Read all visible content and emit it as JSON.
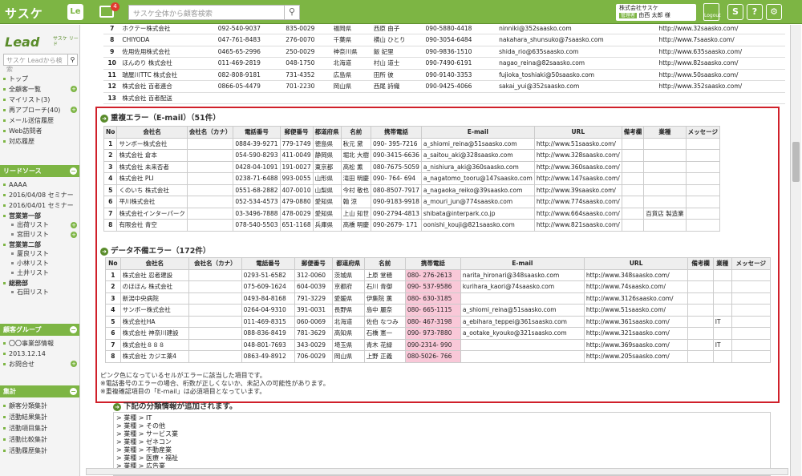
{
  "topbar": {
    "logo": "サスケ",
    "le": "Le",
    "badge": "4",
    "search_placeholder": "サスケ全体から顧客検索",
    "company": "株式会社サスケ",
    "role": "管理者",
    "user": "由西 太郎 様",
    "logout": "Logout"
  },
  "sidebar": {
    "lead_logo": "Lead",
    "lead_sub": "サスケ リード",
    "search_placeholder": "サスケ Leadから検索",
    "items": [
      "トップ",
      "全顧客一覧",
      "マイリスト(3)",
      "再アプローチ(40)",
      "メール送信履歴",
      "Web訪問者",
      "対応履歴"
    ],
    "sec_leadsource": "リードソース",
    "leadsource": [
      "AAAA",
      "2016/04/08 セミナー",
      "2016/04/01 セミナー"
    ],
    "eigyo1": "営業第一部",
    "eigyo1_sub": [
      "出荷リスト",
      "宮田リスト"
    ],
    "eigyo2": "営業第二部",
    "eigyo2_sub": [
      "厦良リスト",
      "小林リスト",
      "土井リスト"
    ],
    "somu": "総務部",
    "somu_sub": [
      "石田リスト"
    ],
    "sec_group": "顧客グループ",
    "group": [
      "〇〇事業部情報",
      "2013.12.14",
      "お問合せ"
    ],
    "sec_aggr": "集計",
    "aggr": [
      "顧客分類集計",
      "活動結果集計",
      "活動項目集計",
      "活動比較集計",
      "活動履歴集計"
    ]
  },
  "top_rows": [
    [
      "7",
      "ホクテー株式会社",
      "",
      "",
      "092-540-9037",
      "835-0029",
      "福岡県",
      "西原 由子",
      "090-5880-4418",
      "ninniki@352saasko.com",
      "http://www.32saasko.com/"
    ],
    [
      "8",
      "CHIYODA",
      "",
      "",
      "047-761-8483",
      "276-0070",
      "千葉県",
      "横山 ひとり",
      "090-3054-6484",
      "nakahara_shunsuko@7saasko.com",
      "http://www.7saasko.com/"
    ],
    [
      "9",
      "佐用佐用株式会社",
      "",
      "",
      "0465-65-2996",
      "250-0029",
      "神奈川県",
      "飯 妃里",
      "090-9836-1510",
      "shida_rio@635saasko.com",
      "http://www.635saasko.com/"
    ],
    [
      "10",
      "ほんのり 株式会社",
      "",
      "",
      "011-469-2819",
      "048-1750",
      "北海道",
      "村山 道士",
      "090-7490-6191",
      "nagao_reina@82saasko.com",
      "http://www.82saasko.com/"
    ],
    [
      "11",
      "瑞屋川TTC 株式会社",
      "",
      "",
      "082-808-9181",
      "731-4352",
      "広島県",
      "田所 彼",
      "090-9140-3353",
      "fujioka_toshiaki@50saasko.com",
      "http://www.50saasko.com/"
    ],
    [
      "12",
      "株式会社 百者連合",
      "",
      "",
      "0866-05-4479",
      "701-2230",
      "岡山県",
      "西尾 詩織",
      "090-9425-4066",
      "sakai_yui@352saasko.com",
      "http://www.352saasko.com/"
    ],
    [
      "13",
      "株式会社 百者配送",
      "",
      "",
      "",
      "",
      "",
      "",
      "",
      "",
      ""
    ]
  ],
  "dup": {
    "title": "重複エラー（E-mail）（51件）",
    "headers": [
      "No",
      "会社名",
      "会社名（カナ）",
      "電話番号",
      "郵便番号",
      "都道府県",
      "名前",
      "携帯電話",
      "E-mail",
      "URL",
      "備考欄",
      "業種",
      "メッセージ"
    ],
    "rows": [
      [
        "1",
        "サンボー株式会社",
        "",
        "0884-39-9271",
        "779-1749",
        "徳島県",
        "秋元 黛",
        "090- 395-7216",
        "a_shiomi_reina@51saasko.com",
        "http://www.51saasko.com/",
        "",
        "",
        ""
      ],
      [
        "2",
        "株式会社 倉本",
        "",
        "054-590-8293",
        "411-0049",
        "静岡県",
        "堀北 大樹",
        "090-3415-6636",
        "a_saitou_aki@328saasko.com",
        "http://www.328saasko.com/",
        "",
        "",
        ""
      ],
      [
        "3",
        "株式会社 未来否者",
        "",
        "0428-04-1091",
        "191-0027",
        "東京都",
        "高松 薫",
        "080-7675-5059",
        "a_nishiura_aki@360saasko.com",
        "http://www.360saasko.com/",
        "",
        "",
        ""
      ],
      [
        "4",
        "株式会社 PLI",
        "",
        "0238-71-6488",
        "993-0055",
        "山形県",
        "滝田 明慶",
        "090- 764- 694",
        "a_nagatomo_tooru@147saasko.com",
        "http://www.147saasko.com/",
        "",
        "",
        ""
      ],
      [
        "5",
        "くのいち 株式会社",
        "",
        "0551-68-2882",
        "407-0010",
        "山梨県",
        "今村 敬也",
        "080-8507-7917",
        "a_nagaoka_reiko@39saasko.com",
        "http://www.39saasko.com/",
        "",
        "",
        ""
      ],
      [
        "6",
        "平川株式会社",
        "",
        "052-534-4573",
        "479-0880",
        "愛知県",
        "翰 涼",
        "090-9183-9918",
        "a_mouri_jun@774saasko.com",
        "http://www.774saasko.com/",
        "",
        "",
        ""
      ],
      [
        "7",
        "株式会社インターパーク",
        "",
        "03-3496-7888",
        "478-0029",
        "愛知県",
        "上山 知世",
        "090-2794-4813",
        "shibata@interpark.co.jp",
        "http://www.664saasko.com/",
        "",
        "百貨店 製造業",
        ""
      ],
      [
        "8",
        "有限会社 青空",
        "",
        "078-540-5503",
        "651-1168",
        "兵庫県",
        "高橋 明慶",
        "090-2679- 171",
        "oonishi_kouji@821saasko.com",
        "http://www.821saasko.com/",
        "",
        "",
        ""
      ]
    ]
  },
  "miss": {
    "title": "データ不備エラー（172件）",
    "headers": [
      "No",
      "会社名",
      "会社名（カナ）",
      "電話番号",
      "郵便番号",
      "都道府県",
      "名前",
      "携帯電話",
      "E-mail",
      "URL",
      "備考欄",
      "業種",
      "メッセージ"
    ],
    "rows": [
      [
        "1",
        "株式会社 忍者建設",
        "",
        "0293-51-6582",
        "312-0060",
        "茨城県",
        "上原 堂穂",
        "080- 276-2613",
        "narita_hironari@348saasko.com",
        "http://www.348saasko.com/",
        "",
        "",
        ""
      ],
      [
        "2",
        "のほほん 株式会社",
        "",
        "075-609-1624",
        "604-0039",
        "京都府",
        "石川 青御",
        "090- 537-9586",
        "kurihara_kaori@74saasko.com",
        "http://www.74saasko.com/",
        "",
        "",
        ""
      ],
      [
        "3",
        "新潟中央病院",
        "",
        "0493-84-8168",
        "791-3229",
        "愛媛県",
        "伊集院 薫",
        "080- 630-3185",
        "",
        "http://www.3126saasko.com/",
        "",
        "",
        ""
      ],
      [
        "4",
        "サンボー株式会社",
        "",
        "0264-04-9310",
        "391-0031",
        "長野県",
        "島中 麗奈",
        "080- 665-1115",
        "a_shiomi_reina@51saasko.com",
        "http://www.51saasko.com/",
        "",
        "",
        ""
      ],
      [
        "5",
        "株式会社HA",
        "",
        "011-469-8315",
        "060-0069",
        "北海道",
        "佐伯 なつみ",
        "080- 467-3198",
        "a_ebihara_teppei@361saasko.com",
        "http://www.361saasko.com/",
        "",
        "IT",
        ""
      ],
      [
        "6",
        "株式会社 神奈川建設",
        "",
        "088-836-8419",
        "781-3629",
        "高知県",
        "石橋 憲一",
        "090- 973-7880",
        "a_ootake_kyouko@321saasko.com",
        "http://www.321saasko.com/",
        "",
        "",
        ""
      ],
      [
        "7",
        "株式会社８８８",
        "",
        "048-801-7693",
        "343-0029",
        "埼玉県",
        "青木 花緑",
        "090-2314- 990",
        "",
        "http://www.369saasko.com/",
        "",
        "IT",
        ""
      ],
      [
        "8",
        "株式会社 カジエ薬4",
        "",
        "0863-49-8912",
        "706-0029",
        "岡山県",
        "上野 正義",
        "080-5026- 766",
        "",
        "http://www.205saasko.com/",
        "",
        "",
        ""
      ]
    ]
  },
  "notes": [
    "ピンク色になっているセルがエラーに該当した項目です。",
    "※電話番号のエラーの場合、桁数が正しくないか、未記入の可能性があります。",
    "※重複確認項目の「E-mail」は必須項目となっています。"
  ],
  "classify": {
    "title": "下記の分類情報が追加されます。",
    "lines": [
      "> 業種 > IT",
      "> 業種 > その他",
      "> 業種 > サービス業",
      "> 業種 > ゼネコン",
      "> 業種 > 不動産業",
      "> 業種 > 医療・福祉",
      "> 業種 > 広告業"
    ]
  }
}
